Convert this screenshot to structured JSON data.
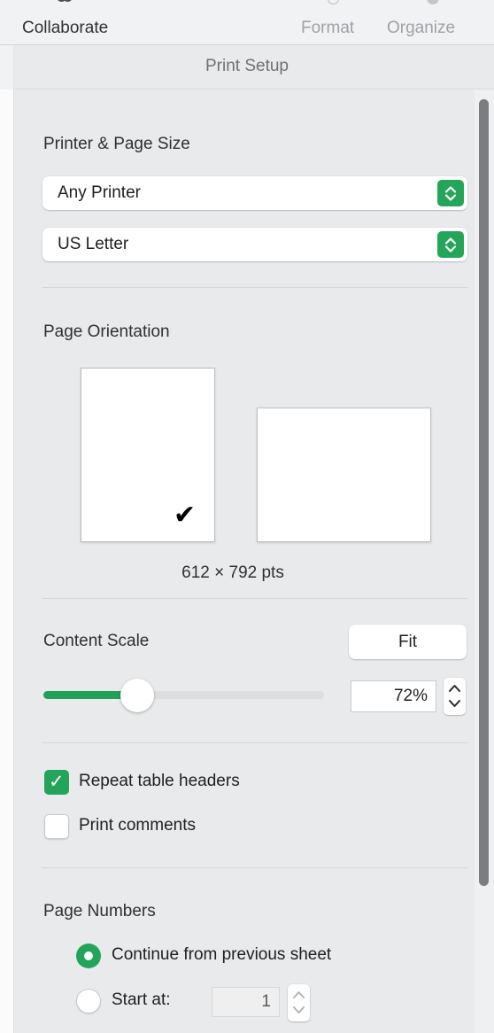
{
  "toolbar": {
    "collaborate_label": "Collaborate",
    "format_label": "Format",
    "organize_label": "Organize"
  },
  "panel": {
    "title": "Print Setup"
  },
  "printer_page_size": {
    "heading": "Printer & Page Size",
    "printer_value": "Any Printer",
    "paper_size_value": "US Letter"
  },
  "page_orientation": {
    "heading": "Page Orientation",
    "portrait_selected": true,
    "landscape_selected": false,
    "check_glyph": "✔",
    "page_size_text": "612 × 792 pts"
  },
  "content_scale": {
    "heading": "Content Scale",
    "fit_label": "Fit",
    "scale_value": "72%",
    "slider_percent": 35
  },
  "options": {
    "repeat_table_headers_label": "Repeat table headers",
    "repeat_table_headers_checked": true,
    "print_comments_label": "Print comments",
    "print_comments_checked": false,
    "check_glyph": "✓"
  },
  "page_numbers": {
    "heading": "Page Numbers",
    "continue_label": "Continue from previous sheet",
    "continue_selected": true,
    "start_at_label": "Start at:",
    "start_at_selected": false,
    "start_at_value": "1"
  },
  "colors": {
    "accent_green": "#23a45a",
    "panel_bg": "#e8eaeb",
    "toolbar_bg": "#f1f2f4"
  }
}
